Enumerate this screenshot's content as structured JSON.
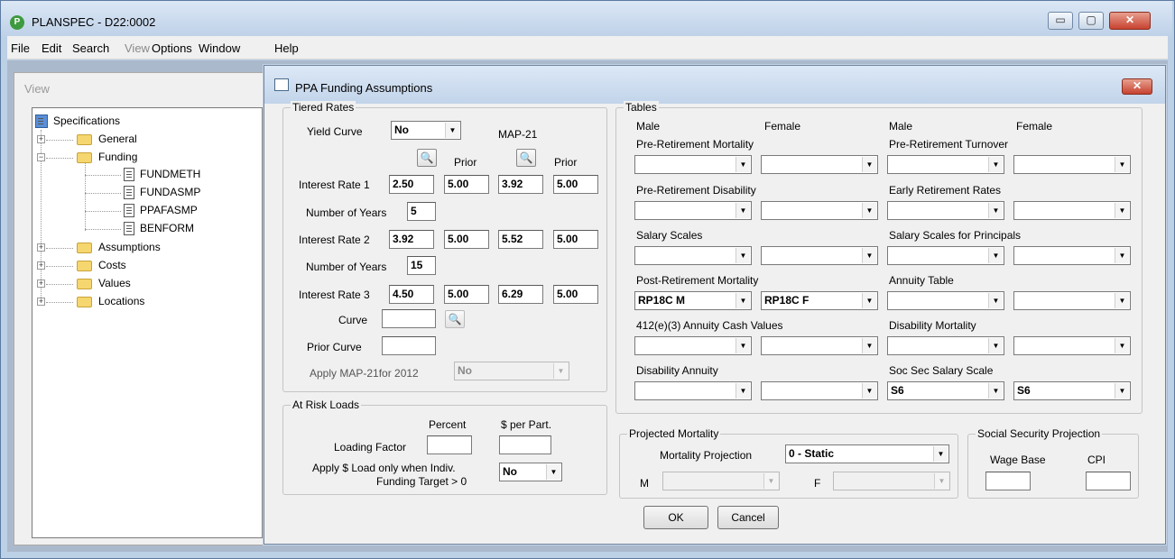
{
  "app": {
    "title": "PLANSPEC - D22:0002",
    "icon_letter": "P"
  },
  "window_controls": {
    "minimize": "▭",
    "maximize": "▢",
    "close": "✕"
  },
  "menu": [
    "File",
    "Edit",
    "Search",
    "View",
    "Options",
    "Window",
    "Help"
  ],
  "view_panel": {
    "title": "View"
  },
  "tree": {
    "root": "Specifications",
    "items": [
      {
        "label": "General",
        "expanded": false
      },
      {
        "label": "Funding",
        "expanded": true
      },
      {
        "label": "FUNDMETH",
        "child": true
      },
      {
        "label": "FUNDASMP",
        "child": true
      },
      {
        "label": "PPAFASMP",
        "child": true
      },
      {
        "label": "BENFORM",
        "child": true
      },
      {
        "label": "Assumptions",
        "expanded": false
      },
      {
        "label": "Costs",
        "expanded": false
      },
      {
        "label": "Values",
        "expanded": false
      },
      {
        "label": "Locations",
        "expanded": false
      }
    ],
    "expand_plus": "+",
    "expand_minus": "−"
  },
  "dialog": {
    "title": "PPA Funding Assumptions",
    "close": "✕",
    "tiered": {
      "legend": "Tiered Rates",
      "yield_curve_label": "Yield Curve",
      "yield_curve_value": "No",
      "map21_label": "MAP-21",
      "prior1": "Prior",
      "prior2": "Prior",
      "ir1_label": "Interest Rate 1",
      "ir1": [
        "2.50",
        "5.00",
        "3.92",
        "5.00"
      ],
      "ny1_label": "Number of Years",
      "ny1": "5",
      "ir2_label": "Interest Rate 2",
      "ir2": [
        "3.92",
        "5.00",
        "5.52",
        "5.00"
      ],
      "ny2_label": "Number of Years",
      "ny2": "15",
      "ir3_label": "Interest Rate 3",
      "ir3": [
        "4.50",
        "5.00",
        "6.29",
        "5.00"
      ],
      "curve_label": "Curve",
      "prior_curve_label": "Prior Curve",
      "apply_label": "Apply MAP-21for 2012",
      "apply_value": "No"
    },
    "risk": {
      "legend": "At Risk Loads",
      "percent": "Percent",
      "per_part": "$ per Part.",
      "loading_label": "Loading Factor",
      "apply_line1": "Apply $ Load only when Indiv.",
      "apply_line2": "Funding Target > 0",
      "apply_value": "No"
    },
    "tables": {
      "legend": "Tables",
      "male1": "Male",
      "female1": "Female",
      "male2": "Male",
      "female2": "Female",
      "rows": [
        {
          "left": "Pre-Retirement Mortality",
          "right": "Pre-Retirement Turnover",
          "values": [
            "",
            "",
            "",
            ""
          ]
        },
        {
          "left": "Pre-Retirement Disability",
          "right": "Early Retirement Rates",
          "values": [
            "",
            "",
            "",
            ""
          ]
        },
        {
          "left": "Salary Scales",
          "right": "Salary Scales for Principals",
          "values": [
            "",
            "",
            "",
            ""
          ]
        },
        {
          "left": "Post-Retirement Mortality",
          "right": "Annuity Table",
          "values": [
            "RP18C M",
            "RP18C F",
            "",
            ""
          ]
        },
        {
          "left": "412(e)(3) Annuity Cash Values",
          "right": "Disability Mortality",
          "values": [
            "",
            "",
            "",
            ""
          ]
        },
        {
          "left": "Disability Annuity",
          "right": "Soc Sec Salary Scale",
          "values": [
            "",
            "",
            "S6",
            "S6"
          ]
        }
      ]
    },
    "projected": {
      "legend": "Projected Mortality",
      "label": "Mortality Projection",
      "value": "0 - Static",
      "m_label": "M",
      "f_label": "F"
    },
    "ssp": {
      "legend": "Social Security Projection",
      "wage_base": "Wage Base",
      "cpi": "CPI"
    },
    "ok": "OK",
    "cancel": "Cancel"
  },
  "icons": {
    "dropdown": "▼",
    "lookup": "🔍"
  }
}
